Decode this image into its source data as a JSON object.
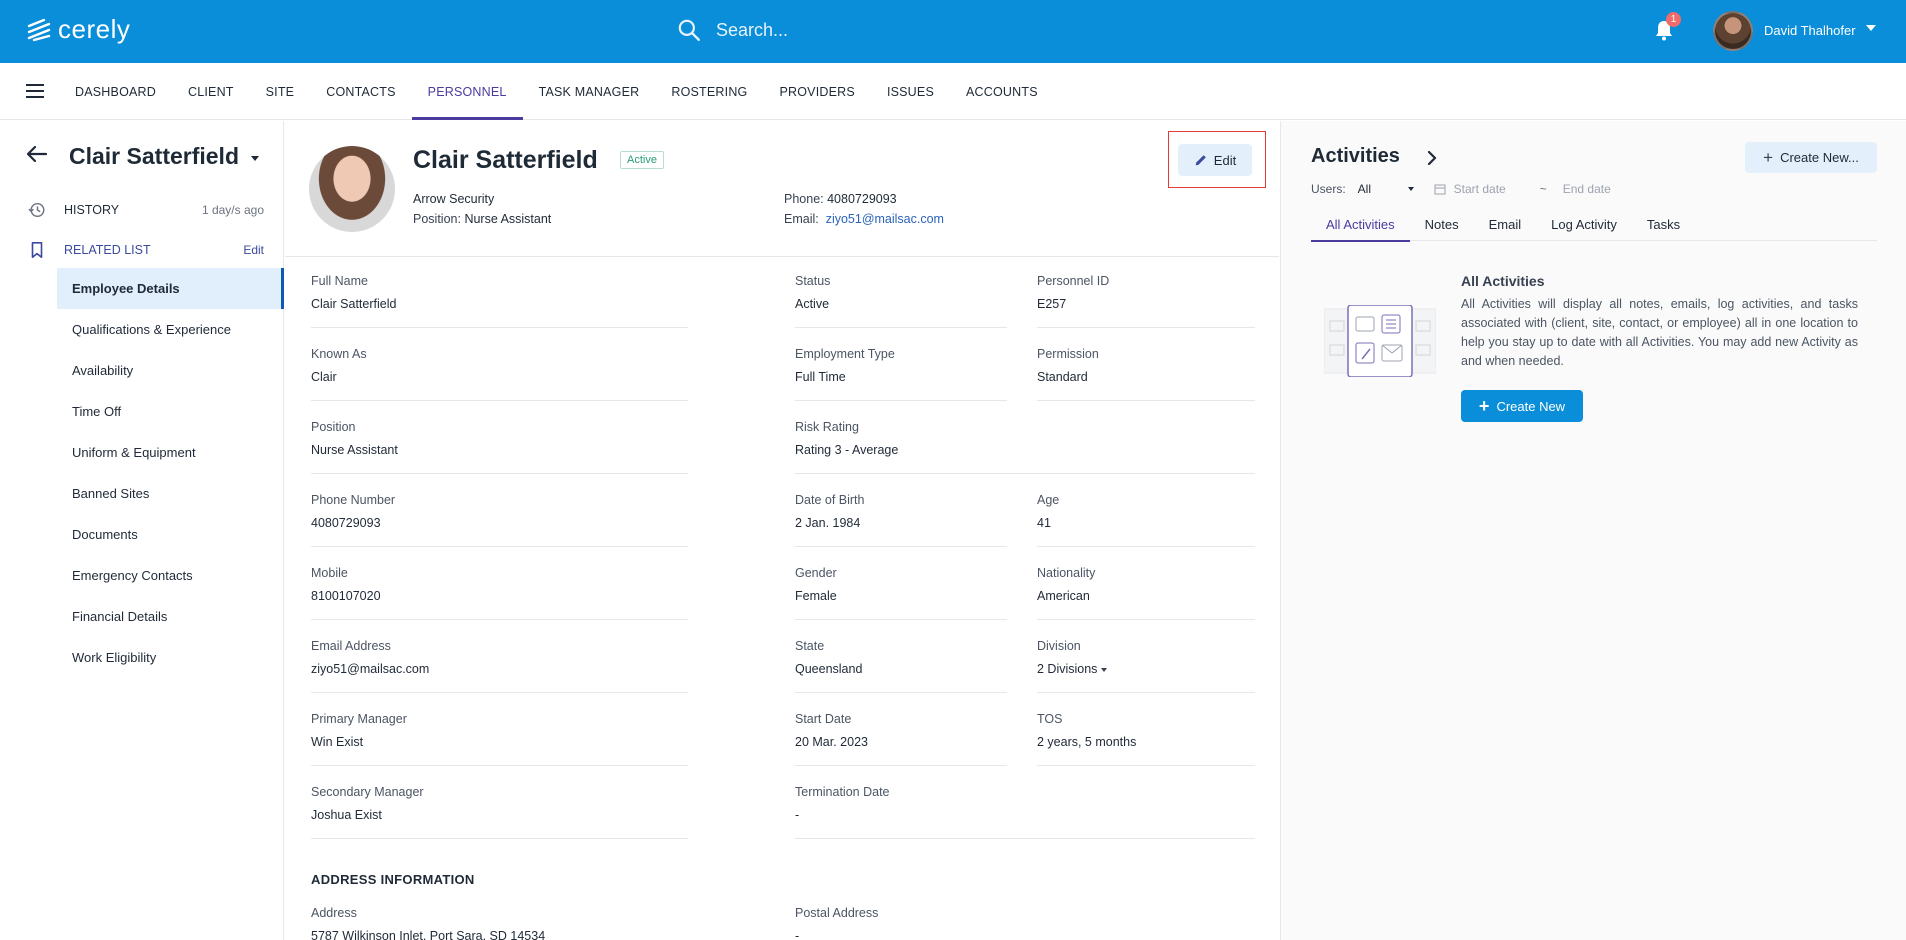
{
  "app": {
    "logo_text": "cerely"
  },
  "header": {
    "search_placeholder": "Search...",
    "notification_count": "1",
    "user_name": "David Thalhofer"
  },
  "nav": {
    "items": [
      "DASHBOARD",
      "CLIENT",
      "SITE",
      "CONTACTS",
      "PERSONNEL",
      "TASK MANAGER",
      "ROSTERING",
      "PROVIDERS",
      "ISSUES",
      "ACCOUNTS"
    ],
    "active": "PERSONNEL"
  },
  "sidebar": {
    "title": "Clair Satterfield",
    "history_label": "HISTORY",
    "history_age": "1 day/s ago",
    "related_label": "RELATED LIST",
    "related_edit": "Edit",
    "items": [
      {
        "label": "Employee Details",
        "active": true
      },
      {
        "label": "Qualifications & Experience"
      },
      {
        "label": "Availability"
      },
      {
        "label": "Time Off"
      },
      {
        "label": "Uniform & Equipment"
      },
      {
        "label": "Banned Sites"
      },
      {
        "label": "Documents"
      },
      {
        "label": "Emergency Contacts"
      },
      {
        "label": "Financial Details"
      },
      {
        "label": "Work Eligibility"
      }
    ]
  },
  "profile": {
    "name": "Clair Satterfield",
    "status": "Active",
    "company": "Arrow Security",
    "position_label": "Position:",
    "position": "Nurse Assistant",
    "phone_label": "Phone:",
    "phone": "4080729093",
    "email_label": "Email:",
    "email": "ziyo51@mailsac.com",
    "edit_label": "Edit"
  },
  "fields": {
    "full_name": {
      "label": "Full Name",
      "value": "Clair Satterfield"
    },
    "status": {
      "label": "Status",
      "value": "Active"
    },
    "personnel_id": {
      "label": "Personnel ID",
      "value": "E257"
    },
    "known_as": {
      "label": "Known As",
      "value": "Clair"
    },
    "employment_type": {
      "label": "Employment Type",
      "value": "Full Time"
    },
    "permission": {
      "label": "Permission",
      "value": "Standard"
    },
    "position": {
      "label": "Position",
      "value": "Nurse Assistant"
    },
    "risk_rating": {
      "label": "Risk Rating",
      "value": "Rating 3 - Average"
    },
    "phone_number": {
      "label": "Phone Number",
      "value": "4080729093"
    },
    "date_of_birth": {
      "label": "Date of Birth",
      "value": "2 Jan. 1984"
    },
    "age": {
      "label": "Age",
      "value": "41"
    },
    "mobile": {
      "label": "Mobile",
      "value": "8100107020"
    },
    "gender": {
      "label": "Gender",
      "value": "Female"
    },
    "nationality": {
      "label": "Nationality",
      "value": "American"
    },
    "email_address": {
      "label": "Email Address",
      "value": "ziyo51@mailsac.com"
    },
    "state": {
      "label": "State",
      "value": "Queensland"
    },
    "division": {
      "label": "Division",
      "value": "2 Divisions"
    },
    "primary_manager": {
      "label": "Primary Manager",
      "value": "Win Exist"
    },
    "start_date": {
      "label": "Start Date",
      "value": "20 Mar. 2023"
    },
    "tos": {
      "label": "TOS",
      "value": "2 years, 5 months"
    },
    "secondary_manager": {
      "label": "Secondary Manager",
      "value": "Joshua Exist"
    },
    "termination_date": {
      "label": "Termination Date",
      "value": "-"
    },
    "address": {
      "label": "Address",
      "value": "5787 Wilkinson Inlet, Port Sara, SD 14534"
    },
    "postal_address": {
      "label": "Postal Address",
      "value": "-"
    }
  },
  "address_heading": "ADDRESS INFORMATION",
  "activities": {
    "title": "Activities",
    "create_label": "Create New...",
    "users_label": "Users:",
    "users_value": "All",
    "start_placeholder": "Start date",
    "range_sep": "~",
    "end_placeholder": "End date",
    "tabs": [
      "All Activities",
      "Notes",
      "Email",
      "Log Activity",
      "Tasks"
    ],
    "active_tab": "All Activities",
    "empty_title": "All Activities",
    "empty_desc": "All Activities will display all notes, emails, log activities, and tasks associated with (client, site, contact, or employee) all in one location to help you stay up to date with all Activities. You may add new Activity as and when needed.",
    "create_new_label": "Create New"
  },
  "colors": {
    "brand": "#0a8ed9",
    "accent": "#4c3a9e",
    "highlight": "#e53935"
  }
}
